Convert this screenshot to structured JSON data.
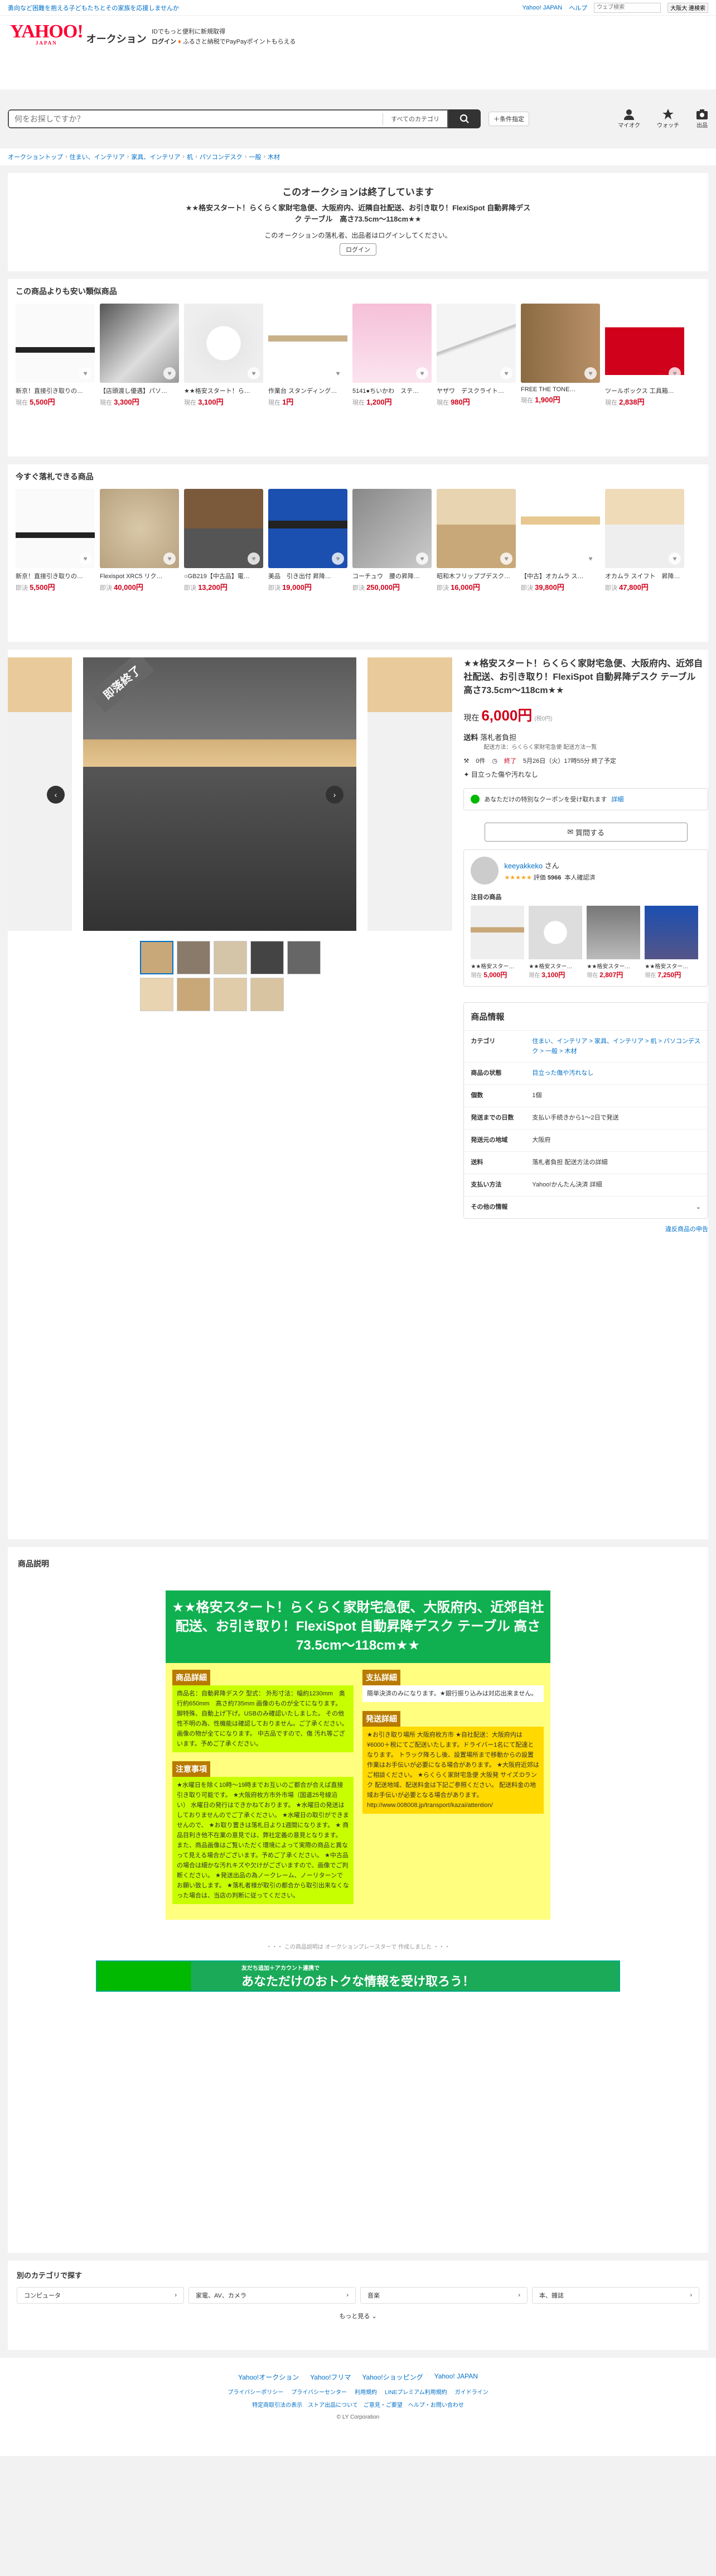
{
  "topbar": {
    "promo": "勇向など困難を抱える子どもたちとその家族を応援しませんか",
    "links": [
      "Yahoo! JAPAN",
      "ヘルプ"
    ],
    "search_placeholder": "ウェブ検索",
    "search_button": "大阪大 連検索"
  },
  "header": {
    "logo": "YAHOO!",
    "logo_sub": "JAPAN",
    "service": "オークション",
    "tagline": "IDでもっと便利に新規取得",
    "login": "ログイン",
    "paypay": "ふるさと納税でPayPayポイントもらえる"
  },
  "search": {
    "placeholder": "何をお探しですか？",
    "category": "すべてのカテゴリ",
    "condition": "＋条件指定"
  },
  "nav_icons": [
    "マイオク",
    "ウォッチ",
    "出品"
  ],
  "breadcrumb": [
    "オークショントップ",
    "住まい、インテリア",
    "家具、インテリア",
    "机",
    "パソコンデスク",
    "一般",
    "木材"
  ],
  "ended": {
    "title": "このオークションは終了しています",
    "item": "★★格安スタート！らくらく家財宅急便、大阪府内、近隣自社配送、お引き取り！FlexiSpot 自動昇降デスク テーブル　高さ73.5cm〜118cm★★",
    "note": "このオークションの落札者、出品者はログインしてください。",
    "login": "ログイン"
  },
  "cheaper": {
    "title": "この商品よりも安い類似商品",
    "items": [
      {
        "t": "新京！直接引き取りの…",
        "p": "5,500円"
      },
      {
        "t": "【店頭渡し優遇】パソ…",
        "p": "3,300円"
      },
      {
        "t": "★★格安スタート！ら…",
        "p": "3,100円"
      },
      {
        "t": "作業台 スタンディング…",
        "p": "1円"
      },
      {
        "t": "5141●ちいかわ　ステ…",
        "p": "1,200円"
      },
      {
        "t": "ヤザワ　デスクライト…",
        "p": "980円"
      },
      {
        "t": "FREE THE TONE…",
        "p": "1,900円"
      },
      {
        "t": "ツールボックス 工具箱…",
        "p": "2,838円"
      }
    ]
  },
  "buynow": {
    "title": "今すぐ落札できる商品",
    "items": [
      {
        "t": "新京！直接引き取りの…",
        "p": "5,500円"
      },
      {
        "t": "Flexispot XRC5 リク…",
        "p": "40,000円"
      },
      {
        "t": "○GB219【中古品】電…",
        "p": "13,200円"
      },
      {
        "t": "美品　引き出付 昇降…",
        "p": "19,000円"
      },
      {
        "t": "コーチュウ　腰の昇降…",
        "p": "250,000円"
      },
      {
        "t": "昭和木フリッププデスク…",
        "p": "16,000円"
      },
      {
        "t": "【中古】オカムラ ス…",
        "p": "39,800円"
      },
      {
        "t": "オカムラ スイフト　昇降…",
        "p": "47,800円"
      }
    ]
  },
  "item": {
    "badge": "即落終了",
    "title": "★★格安スタート！らくらく家財宅急便、大阪府内、近郊自社配送、お引き取り！FlexiSpot 自動昇降デスク テーブル　高さ73.5cm〜118cm★★",
    "price_label": "現在",
    "price": "6,000円",
    "tax": "(税0円)",
    "ship_label": "送料",
    "ship": "落札者負担",
    "ship_note": "配送方法：らくらく家財宅急便 配送方法一覧",
    "bids": "0件",
    "end": "終了",
    "end_time": "5月26日（火）17時55分 終了予定",
    "condition": "目立った傷や汚れなし",
    "coupon": "あなただけの特別なクーポンを受け取れます",
    "coupon_link": "詳細",
    "question": "質問する"
  },
  "seller": {
    "name": "keeyakkeko",
    "suffix": "さん",
    "rating": "評価",
    "count": "5966",
    "verified": "本人確認済",
    "sub": "注目の商品",
    "items": [
      {
        "t": "★★格安スター…",
        "p": "5,000円"
      },
      {
        "t": "★★格安スター…",
        "p": "3,100円"
      },
      {
        "t": "★★格安スター…",
        "p": "2,807円"
      },
      {
        "t": "★★格安スター…",
        "p": "7,250円"
      }
    ]
  },
  "details": {
    "title": "商品情報",
    "rows": [
      {
        "k": "カテゴリ",
        "v": "住まい、インテリア > 家具、インテリア > 机 > パソコンデスク > 一般 > 木材"
      },
      {
        "k": "商品の状態",
        "v": "目立った傷や汚れなし"
      },
      {
        "k": "個数",
        "v": "1個"
      },
      {
        "k": "発送までの日数",
        "v": "支払い手続きから1〜2日で発送"
      },
      {
        "k": "発送元の地域",
        "v": "大阪府"
      },
      {
        "k": "送料",
        "v": "落札者負担 配送方法の詳細"
      },
      {
        "k": "支払い方法",
        "v": "Yahoo!かんたん決済 詳細"
      },
      {
        "k": "その他の情報",
        "v": ""
      }
    ],
    "report": "違反商品の申告"
  },
  "description": {
    "title": "商品説明",
    "head": "★★格安スタート！らくらく家財宅急便、大阪府内、近郊自社配送、お引き取り！FlexiSpot 自動昇降デスク テーブル 高さ73.5cm〜118cm★★",
    "s1": "商品詳細",
    "s1t": "商品名：自動昇降デスク 型式： 外形寸法：幅約1230mm　奥行約650mm　高さ約735mm 画像のものが全てになります。 脚特殊、自動上げ下げ。USBのみ確認いたしました。 その他性不明の為、性機能は確認しておりません。ご了承ください。 画像の物が全てになります。 中古品ですので、傷 汚れ等ございます。予めご了承ください。",
    "s2": "注意事項",
    "s2t": "★水曜日を除く10時〜19時までお互いのご都合が合えば直接引き取り可能です。 ★大阪府枚方市外市場（国道25号線沿い） 水曜日の発行はできかねております。 ★水曜日の発送はしておりませんのでご了承ください。 ★水曜日の取引ができませんので、 ★お取り置きは落札日より1週間になります。 ★ 商品目利き他不在業の意見では、弊社定義の意見となります。 また、商品画像はご覧いただく環境によって実際の商品と異なって見える場合がございます。予めご了承ください。 ★中古品の場合は細かな汚れキズや欠けがございますので、画像でご判断ください。 ★発送出品の為ノークレーム、ノーリターンでお願い致します。 ★落札者様が取引の都合から取引出来なくなった場合は、当店の判断に従ってください。",
    "s3": "支払詳細",
    "s3t": "簡単決済のみになります。★銀行振り込みは対応出来ません。",
    "s4": "発送詳細",
    "s4t": "★お引き取り場所 大阪府枚方市 ★自社配送：大阪府内は¥6000＋税にてご配送いたします。ドライバー1名にて配達となります。 トラック降ろし後、設置場所まで移動からの設置作業はお手伝いが必要になる場合があります。 ★大阪府近郊はご相談ください。 ★らくらく家財宅急便 大阪発 サイズ:Dランク 配送地域、配送料金は下記ご参照ください。 配送料金の地域お手伝いが必要となる場合があります。 http://www.008008.jp/transport/kazai/attention/",
    "footnote": "・・・ この商品説明は オークションプレースターで 作成しました ・・・"
  },
  "banner": {
    "small": "友だち追加＋アカウント連携で",
    "big": "あなただけのおトクな情報を受け取ろう！"
  },
  "categories": {
    "title": "別のカテゴリで探す",
    "items": [
      "コンピュータ",
      "家電、AV、カメラ",
      "音楽",
      "本、雑誌"
    ],
    "more": "もっと見る"
  },
  "footer": {
    "links": [
      "Yahoo!オークション",
      "Yahoo!フリマ",
      "Yahoo!ショッピング",
      "Yahoo! JAPAN"
    ],
    "links2": [
      "プライバシーポリシー",
      "プライバシーセンター",
      "利用規約",
      "LINEプレミアム利用規約",
      "ガイドライン"
    ],
    "links3": [
      "特定商取引法の表示",
      "ストア出品について",
      "ご意見・ご要望",
      "ヘルプ・お問い合わせ"
    ],
    "copy": "© LY Corporation"
  }
}
